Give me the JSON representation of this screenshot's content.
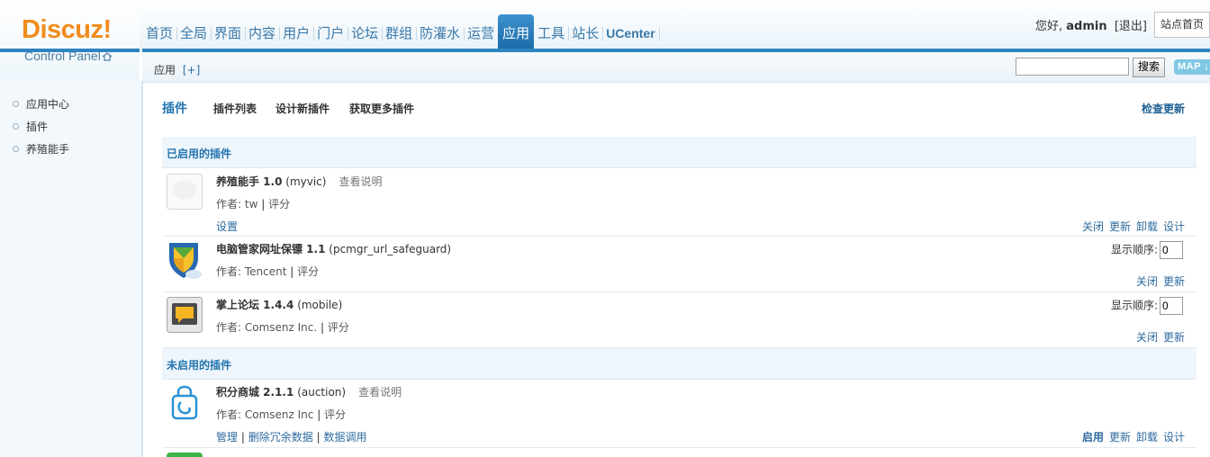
{
  "logo": {
    "brand": "Discuz!",
    "sub": "Control Panel"
  },
  "nav": [
    "首页",
    "全局",
    "界面",
    "内容",
    "用户",
    "门户",
    "论坛",
    "群组",
    "防灌水",
    "运营",
    "应用",
    "工具",
    "站长",
    "UCenter"
  ],
  "nav_active": "应用",
  "topright": {
    "greet_prefix": "您好, ",
    "user": "admin",
    "logout": "[退出]",
    "site_home": "站点首页"
  },
  "subbar": {
    "title": "应用",
    "plus": "[+]",
    "search_button": "搜索",
    "map_button": "MAP ↓"
  },
  "sidebar": [
    "应用中心",
    "插件",
    "养殖能手"
  ],
  "tabs": {
    "current": "插件",
    "items": [
      "插件列表",
      "设计新插件",
      "获取更多插件"
    ],
    "check_update": "检查更新"
  },
  "enabled_section": "已启用的插件",
  "disabled_section": "未启用的插件",
  "plugins": [
    {
      "title": "养殖能手 1.0",
      "id": "(myvic)",
      "doc": "查看说明",
      "author": "作者: tw",
      "rate": "评分",
      "links": [
        "设置"
      ],
      "ops": [
        "关闭",
        "更新",
        "卸载",
        "设计"
      ],
      "order_label": "",
      "order_value": ""
    },
    {
      "title": "电脑管家网址保镖 1.1",
      "id": "(pcmgr_url_safeguard)",
      "doc": "",
      "author": "作者: Tencent",
      "rate": "评分",
      "links": [],
      "ops": [
        "关闭",
        "更新"
      ],
      "order_label": "显示顺序:",
      "order_value": "0"
    },
    {
      "title": "掌上论坛 1.4.4",
      "id": "(mobile)",
      "doc": "",
      "author": "作者: Comsenz Inc.",
      "rate": "评分",
      "links": [],
      "ops": [
        "关闭",
        "更新"
      ],
      "order_label": "显示顺序:",
      "order_value": "0"
    },
    {
      "title": "积分商城 2.1.1",
      "id": "(auction)",
      "doc": "查看说明",
      "author": "作者: Comsenz Inc",
      "rate": "评分",
      "links": [
        "管理",
        "删除冗余数据",
        "数据调用"
      ],
      "ops": [
        "启用",
        "更新",
        "卸载",
        "设计"
      ],
      "order_label": "",
      "order_value": ""
    }
  ],
  "colors": {
    "accent": "#2f83c1",
    "link": "#2e6a9e",
    "logo_orange": "#f08c1d"
  }
}
